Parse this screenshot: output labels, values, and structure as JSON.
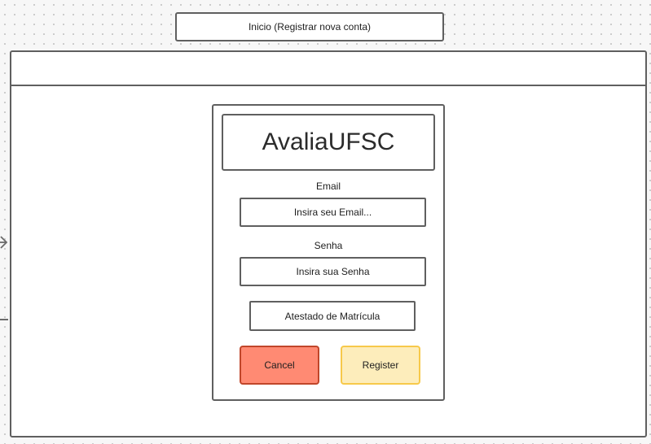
{
  "frame": {
    "title": "Inicio (Registrar nova conta)"
  },
  "login": {
    "app_name": "AvaliaUFSC",
    "email_label": "Email",
    "email_placeholder": "Insira seu Email...",
    "password_label": "Senha",
    "password_placeholder": "Insira sua Senha",
    "attachment_button": "Atestado de Matrícula",
    "cancel_button": "Cancel",
    "register_button": "Register"
  },
  "colors": {
    "cancel_fill": "#ff8a73",
    "cancel_border": "#c0462a",
    "register_fill": "#fdedbb",
    "register_border": "#f7c94a",
    "wireframe_border": "#5f5f5f"
  }
}
